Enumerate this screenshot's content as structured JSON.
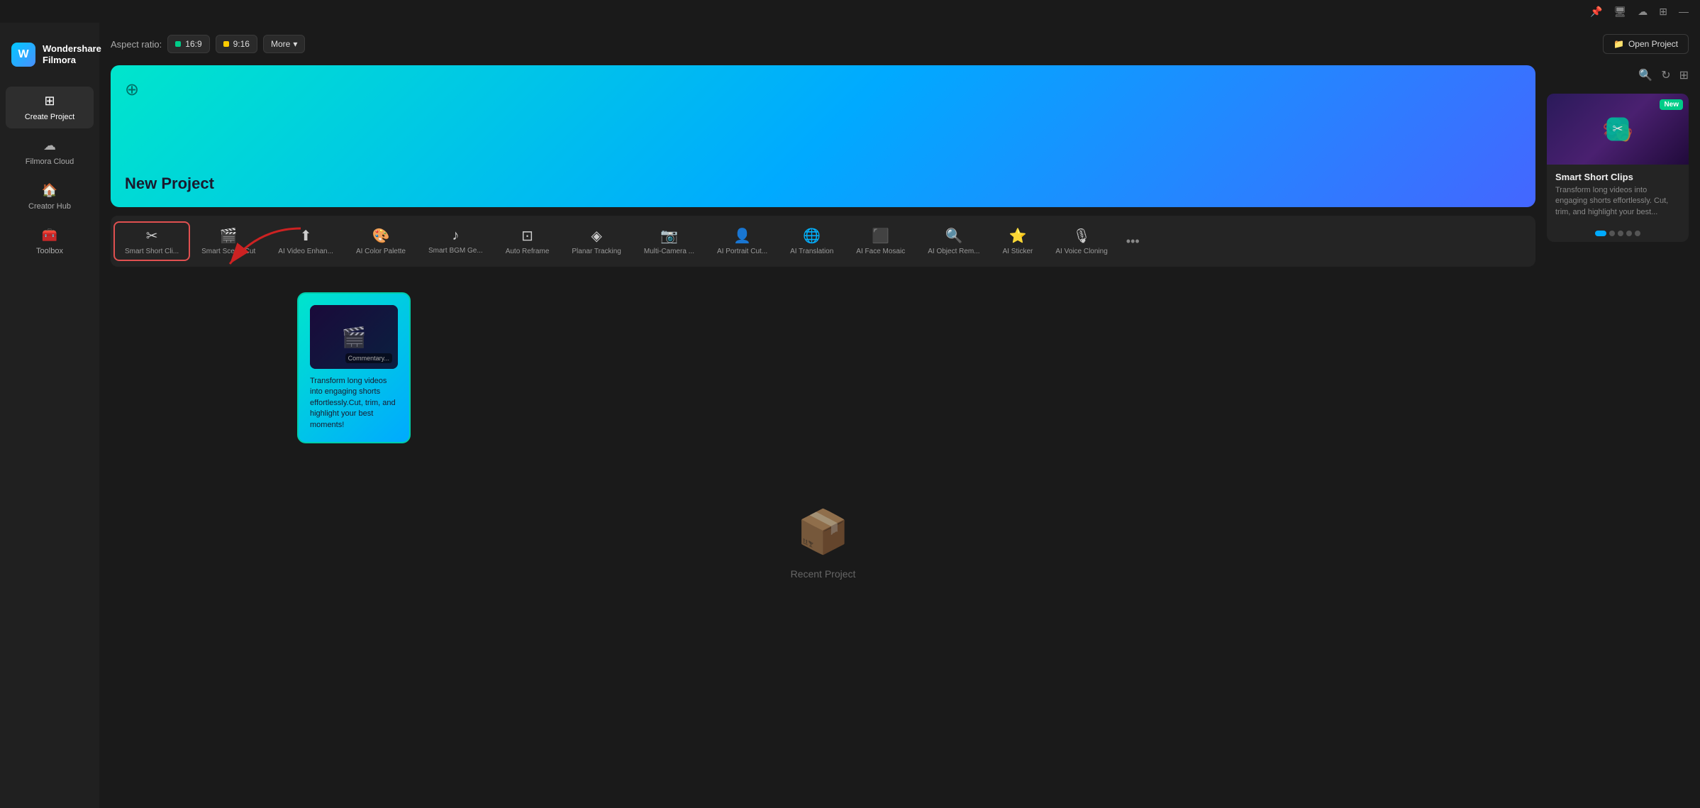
{
  "system_bar": {
    "icons": [
      "pin",
      "display",
      "cloud",
      "grid",
      "minimize"
    ]
  },
  "sidebar": {
    "logo": {
      "icon": "W",
      "line1": "Wondershare",
      "line2": "Filmora"
    },
    "items": [
      {
        "id": "create-project",
        "label": "Create Project",
        "icon": "⊞",
        "active": true
      },
      {
        "id": "filmora-cloud",
        "label": "Filmora Cloud",
        "icon": "☁",
        "active": false
      },
      {
        "id": "creator-hub",
        "label": "Creator Hub",
        "icon": "🏠",
        "active": false
      },
      {
        "id": "toolbox",
        "label": "Toolbox",
        "icon": "🧰",
        "active": false
      }
    ]
  },
  "top_bar": {
    "aspect_ratio_label": "Aspect ratio:",
    "btn_169": "16:9",
    "btn_916": "9:16",
    "btn_more": "More",
    "btn_open_project": "Open Project"
  },
  "new_project": {
    "label": "New Project"
  },
  "tools": [
    {
      "id": "smart-short-clips",
      "label": "Smart Short Cli...",
      "icon": "✂",
      "active": true
    },
    {
      "id": "smart-scene-cut",
      "label": "Smart Scene Cut",
      "icon": "🎬",
      "active": false
    },
    {
      "id": "ai-video-enhance",
      "label": "AI Video Enhan...",
      "icon": "⬆",
      "active": false
    },
    {
      "id": "ai-color-palette",
      "label": "AI Color Palette",
      "icon": "🎨",
      "active": false
    },
    {
      "id": "smart-bgm-gen",
      "label": "Smart BGM Ge...",
      "icon": "♪",
      "active": false
    },
    {
      "id": "auto-reframe",
      "label": "Auto Reframe",
      "icon": "⊡",
      "active": false
    },
    {
      "id": "planar-tracking",
      "label": "Planar Tracking",
      "icon": "◈",
      "active": false
    },
    {
      "id": "multi-camera",
      "label": "Multi-Camera ...",
      "icon": "📷",
      "active": false
    },
    {
      "id": "ai-portrait-cut",
      "label": "AI Portrait Cut...",
      "icon": "👤",
      "active": false
    },
    {
      "id": "ai-translation",
      "label": "AI Translation",
      "icon": "🌐",
      "active": false
    },
    {
      "id": "ai-face-mosaic",
      "label": "AI Face Mosaic",
      "icon": "⬛",
      "active": false
    },
    {
      "id": "ai-object-remove",
      "label": "AI Object Rem...",
      "icon": "🔍",
      "active": false
    },
    {
      "id": "ai-sticker",
      "label": "AI Sticker",
      "icon": "⭐",
      "active": false
    },
    {
      "id": "ai-voice-cloning",
      "label": "AI Voice Cloning",
      "icon": "🎙",
      "active": false
    }
  ],
  "tooltip": {
    "text": "Transform long videos into engaging shorts effortlessly.Cut, trim, and highlight your best moments!"
  },
  "recent": {
    "empty_icon": "📦",
    "label": "Recent Project"
  },
  "feature_card": {
    "badge": "New",
    "title": "Smart Short Clips",
    "description": "Transform long videos into engaging shorts effortlessly. Cut, trim, and highlight your best...",
    "dots": [
      true,
      false,
      false,
      false,
      false
    ]
  },
  "right_panel_actions": {
    "search_icon": "🔍",
    "refresh_icon": "↻",
    "grid_icon": "⊞"
  },
  "colors": {
    "accent": "#00e5cc",
    "active_border": "#e05050",
    "new_badge": "#00cc88"
  }
}
